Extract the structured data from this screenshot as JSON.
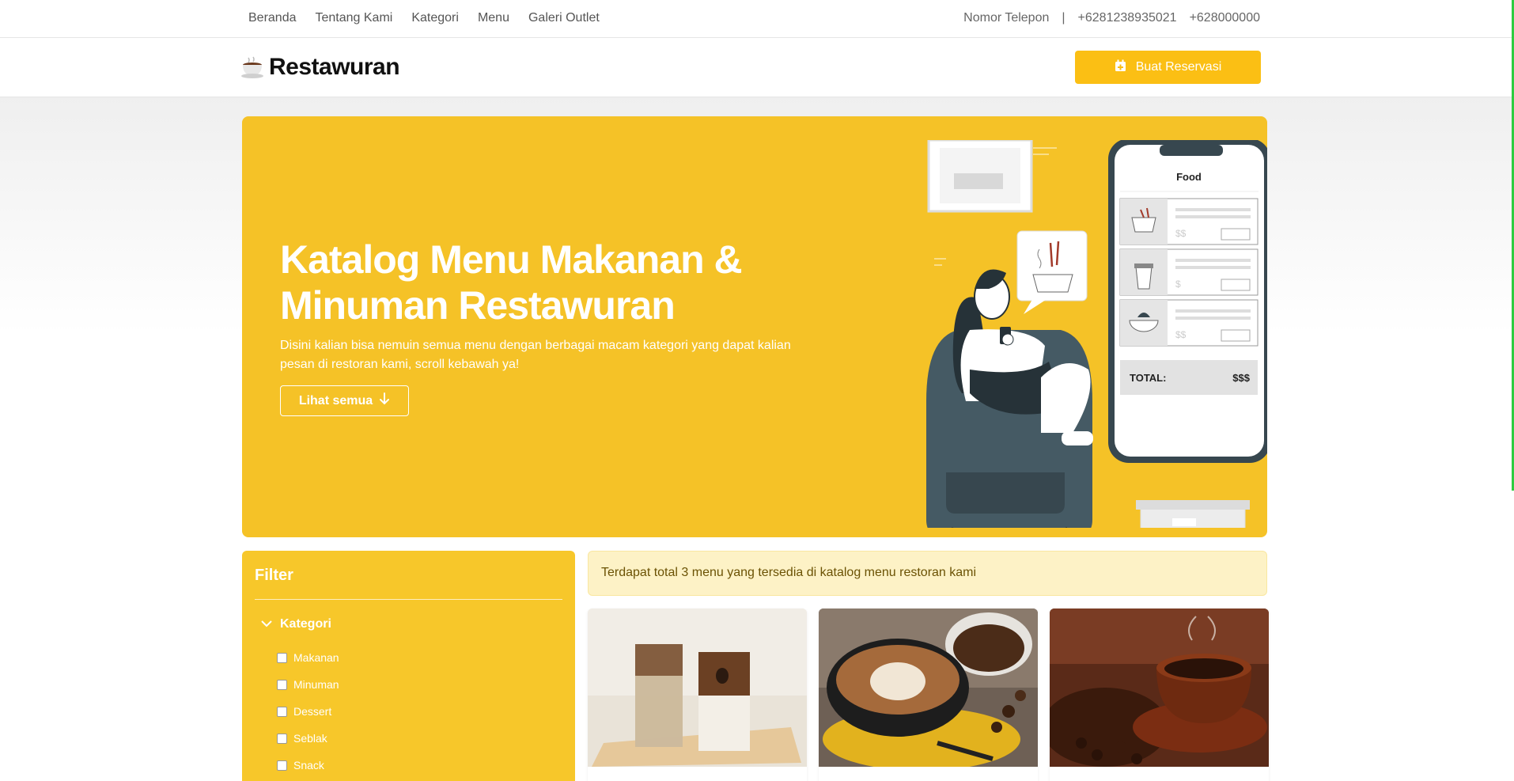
{
  "topbar": {
    "nav": [
      "Beranda",
      "Tentang Kami",
      "Kategori",
      "Menu",
      "Galeri Outlet"
    ],
    "phone_label": "Nomor Telepon",
    "separator": "|",
    "phones": [
      "+6281238935021",
      "+628000000"
    ]
  },
  "header": {
    "brand_name": "Restawuran",
    "reserve_button": "Buat Reservasi"
  },
  "hero": {
    "title_line1": "Katalog Menu Makanan &",
    "title_line2": "Minuman Restawuran",
    "description": "Disini kalian bisa nemuin semua menu dengan berbagai macam kategori yang dapat kalian pesan di restoran kami, scroll kebawah ya!",
    "button": "Lihat semua",
    "phone_screen": {
      "title": "Food",
      "prices": [
        "$$",
        "$",
        "$$"
      ],
      "total_label": "TOTAL:",
      "total_value": "$$$"
    }
  },
  "filter": {
    "title": "Filter",
    "category_label": "Kategori",
    "options": [
      "Makanan",
      "Minuman",
      "Dessert",
      "Seblak",
      "Snack"
    ]
  },
  "info": {
    "text": "Terdapat total 3 menu yang tersedia di katalog menu restoran kami"
  },
  "menu_cards": [
    {
      "image": "iced-coffee-glasses"
    },
    {
      "image": "latte-art-cup"
    },
    {
      "image": "coffee-cup-beans"
    }
  ],
  "colors": {
    "accent": "#fbbf14",
    "hero_bg": "#f5c227",
    "filter_bg": "#f7c72a",
    "info_bg": "#fdf2c6"
  }
}
